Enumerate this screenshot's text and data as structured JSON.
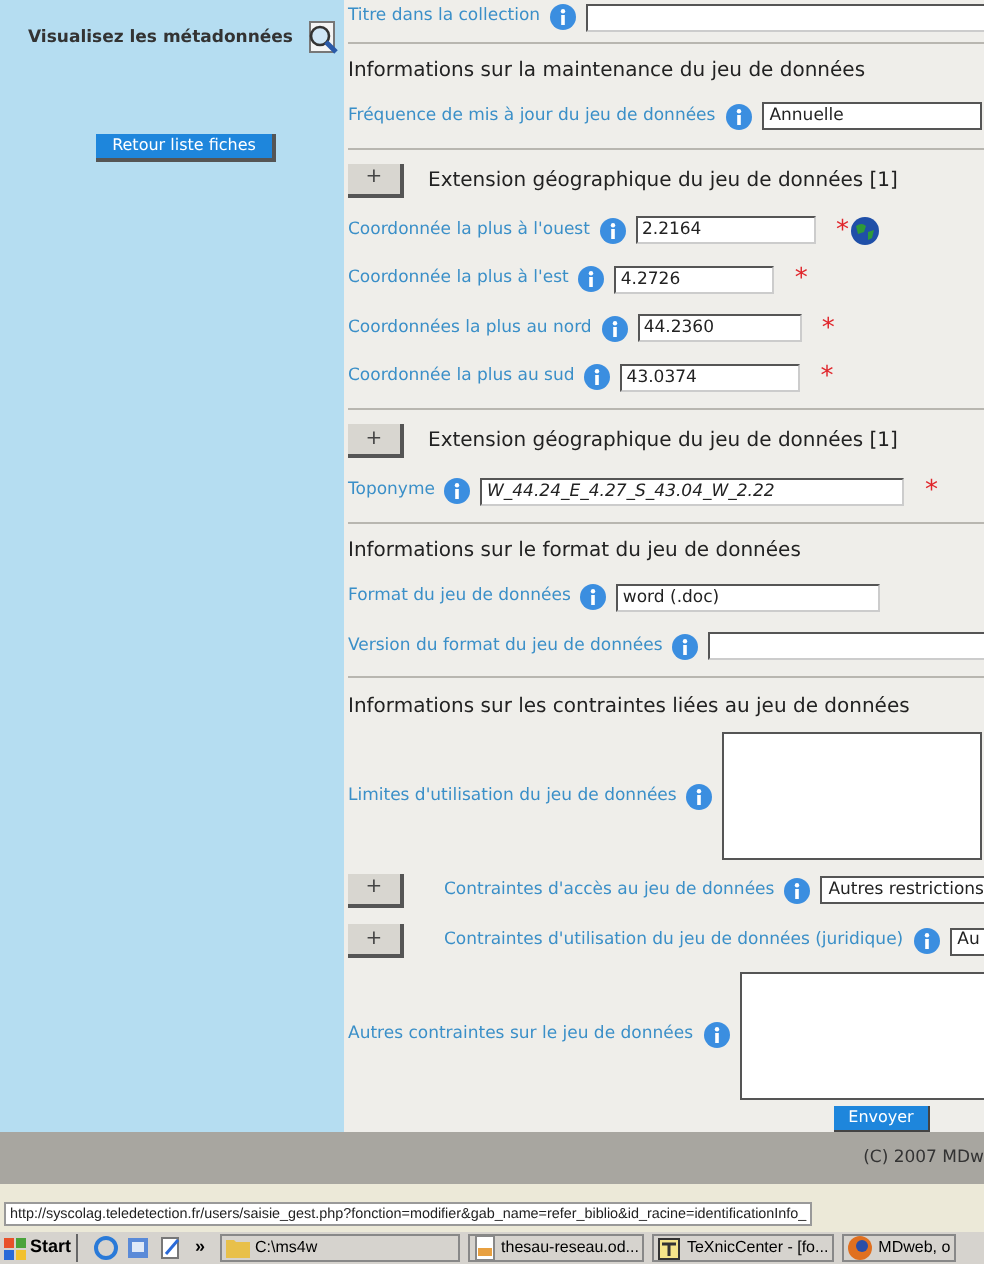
{
  "sidebar": {
    "title": "Visualisez les métadonnées",
    "button": "Retour liste fiches"
  },
  "rows": [
    {
      "kind": "field",
      "label": "Titre dans la collection",
      "value": ""
    },
    {
      "kind": "divider"
    },
    {
      "kind": "heading",
      "label": "Informations sur la maintenance du jeu de données"
    },
    {
      "kind": "select",
      "label": "Fréquence de mis à jour du jeu de données",
      "value": "Annuelle"
    },
    {
      "kind": "divider"
    },
    {
      "kind": "group",
      "label": "Extension géographique du jeu de données [1]",
      "button": "+"
    },
    {
      "kind": "field",
      "label": "Coordonnée la plus à l'ouest",
      "value": "2.2164",
      "mark": "*",
      "map": true
    },
    {
      "kind": "field",
      "label": "Coordonnée la plus à l'est",
      "value": "4.2726",
      "mark": "*"
    },
    {
      "kind": "field",
      "label": "Coordonnées la plus au nord",
      "value": "44.2360",
      "mark": "*"
    },
    {
      "kind": "field",
      "label": "Coordonnée la plus au sud",
      "value": "43.0374",
      "mark": "*"
    },
    {
      "kind": "divider"
    },
    {
      "kind": "group",
      "label": "Extension géographique du jeu de données [1]",
      "button": "+"
    },
    {
      "kind": "field",
      "label": "Toponyme",
      "value": "W_44.24_E_4.27_S_43.04_W_2.22",
      "mark": "*",
      "italic": true
    },
    {
      "kind": "divider"
    },
    {
      "kind": "heading",
      "label": "Informations sur le format du jeu de données"
    },
    {
      "kind": "field",
      "label": "Format du jeu de données",
      "value": "word (.doc)"
    },
    {
      "kind": "field",
      "label": "Version du format du jeu de données",
      "value": ""
    },
    {
      "kind": "divider"
    },
    {
      "kind": "heading",
      "label": "Informations sur les contraintes liées au jeu de données"
    },
    {
      "kind": "textarea",
      "label": "Limites d'utilisation du jeu de données"
    },
    {
      "kind": "groupselect",
      "label": "Contraintes d'accès au jeu de données",
      "button": "+",
      "value": "Autres restrictions"
    },
    {
      "kind": "groupselect",
      "label": "Contraintes d'utilisation du jeu de données (juridique)",
      "button": "+",
      "value": "Au"
    },
    {
      "kind": "textarea",
      "label": "Autres contraintes sur le jeu de données"
    }
  ],
  "submit": "Envoyer",
  "footer": "(C) 2007 MDw",
  "status_url": "http://syscolag.teledetection.fr/users/saisie_gest.php?fonction=modifier&gab_name=refer_biblio&id_racine=identificationInfo_",
  "taskbar": {
    "start": "Start",
    "chevron": "»",
    "tasks": [
      {
        "label": "C:\\ms4w"
      },
      {
        "label": "thesau-reseau.od..."
      },
      {
        "label": "TeXnicCenter - [fo..."
      },
      {
        "label": "MDweb, o"
      }
    ]
  }
}
